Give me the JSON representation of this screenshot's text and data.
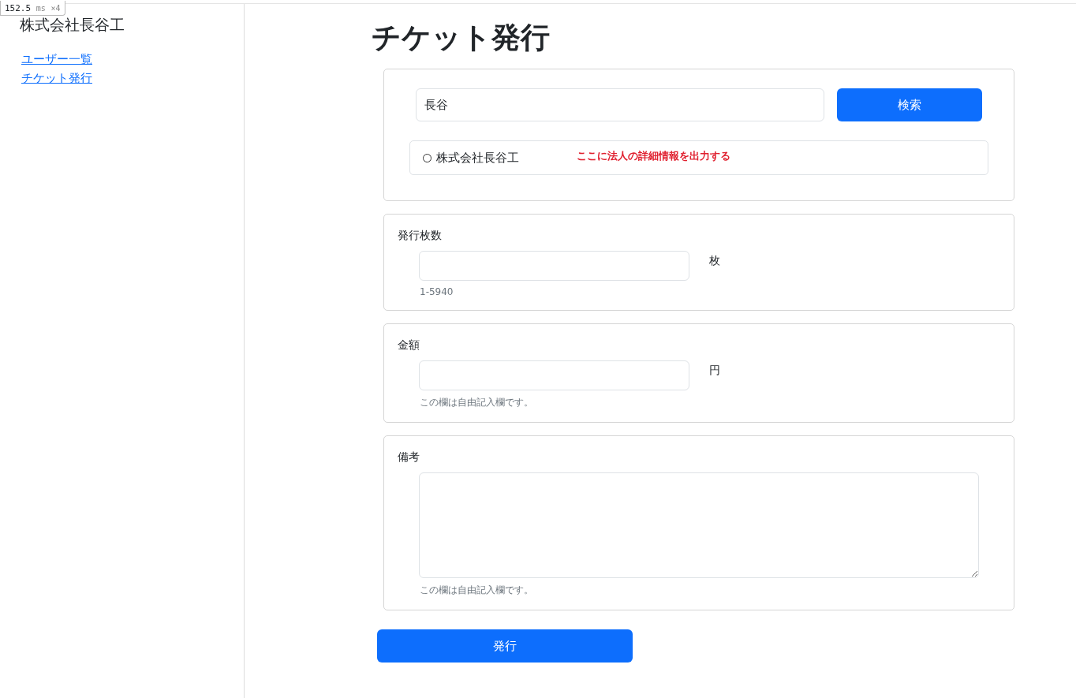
{
  "perf_badge": {
    "value": "152.5",
    "unit": "ms",
    "count": "×4"
  },
  "sidebar": {
    "title": "株式会社長谷工",
    "links": [
      "ユーザー一覧",
      "チケット発行"
    ]
  },
  "page_title": "チケット発行",
  "search": {
    "value": "長谷",
    "button": "検索",
    "results": [
      {
        "label": "株式会社長谷工",
        "selected": false,
        "note": "ここに法人の詳細情報を出力する"
      }
    ]
  },
  "fields": [
    {
      "kind": "input",
      "label": "発行枚数",
      "unit": "枚",
      "help": "1-5940"
    },
    {
      "kind": "input",
      "label": "金額",
      "unit": "円",
      "help": "この欄は自由記入欄です。"
    },
    {
      "kind": "textarea",
      "label": "備考",
      "help": "この欄は自由記入欄です。"
    }
  ],
  "submit": "発行"
}
